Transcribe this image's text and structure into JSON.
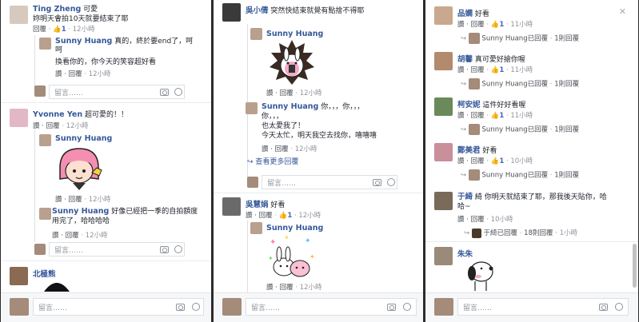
{
  "common": {
    "reply": "回覆",
    "reply_dot": "· 回覆",
    "like": "讚",
    "input_placeholder": "留言……"
  },
  "p1": {
    "c1": {
      "name": "Ting Zheng",
      "text1": "可愛",
      "text2": "妳明天會拍10天就要結束了耶",
      "meta_reply": "回覆",
      "meta_likes": "1",
      "meta_time": "12小時"
    },
    "r1": {
      "name": "Sunny Huang",
      "text": "真的，終於要end了，呵呵",
      "text2": "換看你的，你今天的笑容超好看",
      "meta_time": "12小時"
    },
    "c2": {
      "name": "Yvonne Yen",
      "text": "超可愛的！！",
      "meta_time": "12小時"
    },
    "r2": {
      "name": "Sunny Huang",
      "meta_time": "12小時"
    },
    "r3": {
      "name": "Sunny Huang",
      "text": "好像已經把一季的自拍額度用完了，哈哈哈哈",
      "meta_time": "12小時"
    },
    "c3": {
      "name": "北極熊"
    }
  },
  "p2": {
    "c1": {
      "name": "吳小倩",
      "text": "突然快結束就覺有點捨不得耶"
    },
    "r1": {
      "name": "Sunny Huang",
      "meta_time": "12小時"
    },
    "r2": {
      "name": "Sunny Huang",
      "text1": "你，，，你，，，",
      "text2": "你，，，",
      "text3": "也太愛我了！",
      "text4": "今天太忙，明天我空去找你，嘻嘻嘻",
      "meta_time": "12小時"
    },
    "more": "查看更多回覆",
    "c2": {
      "name": "吳慧娟",
      "text": "好看",
      "meta_likes": "1",
      "meta_time": "12小時"
    },
    "r3": {
      "name": "Sunny Huang",
      "meta_time": "12小時"
    }
  },
  "p3": {
    "comments": [
      {
        "name": "品嫻",
        "text": "好看",
        "likes": "1",
        "time": "11小時",
        "sub": "Sunny Huang已回覆",
        "subcount": "1則回覆"
      },
      {
        "name": "胡馨",
        "text": "真可愛好搶你喔",
        "likes": "1",
        "time": "11小時",
        "sub": "Sunny Huang已回覆",
        "subcount": "1則回覆"
      },
      {
        "name": "柯安妮",
        "text": "這件好好看喔",
        "likes": "1",
        "time": "11小時",
        "sub": "Sunny Huang已回覆",
        "subcount": "1則回覆"
      },
      {
        "name": "鄭美君",
        "text": "好看",
        "likes": "1",
        "time": "10小時",
        "sub": "Sunny Huang已回覆",
        "subcount": "1則回覆"
      }
    ],
    "c5": {
      "name": "于綺",
      "text1": "綺 你明天就結束了耶，那我後天貼你，哈",
      "text2": "哈~",
      "time": "10小時",
      "sub": "于綺已回覆",
      "subcount": "18則回覆",
      "subtime": "1小時"
    },
    "c6": {
      "name": "朱朱"
    }
  }
}
